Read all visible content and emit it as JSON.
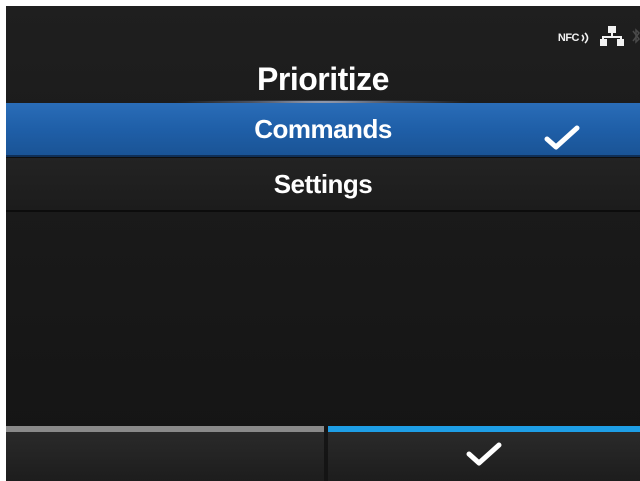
{
  "status_bar": {
    "nfc_label": "NFC",
    "icons": [
      "nfc-icon",
      "network-icon",
      "bluetooth-icon"
    ]
  },
  "header": {
    "title": "Prioritize"
  },
  "menu": {
    "items": [
      {
        "label": "Commands",
        "selected": true
      },
      {
        "label": "Settings",
        "selected": false
      }
    ]
  },
  "soft_keys": {
    "left": {
      "icon": "",
      "indicator_color": "#8a8a8a"
    },
    "right": {
      "icon": "checkmark-icon",
      "indicator_color": "#1e9ee6"
    }
  },
  "colors": {
    "selection": "#1f5fa8",
    "accent": "#1e9ee6",
    "background": "#1a1a1a"
  }
}
